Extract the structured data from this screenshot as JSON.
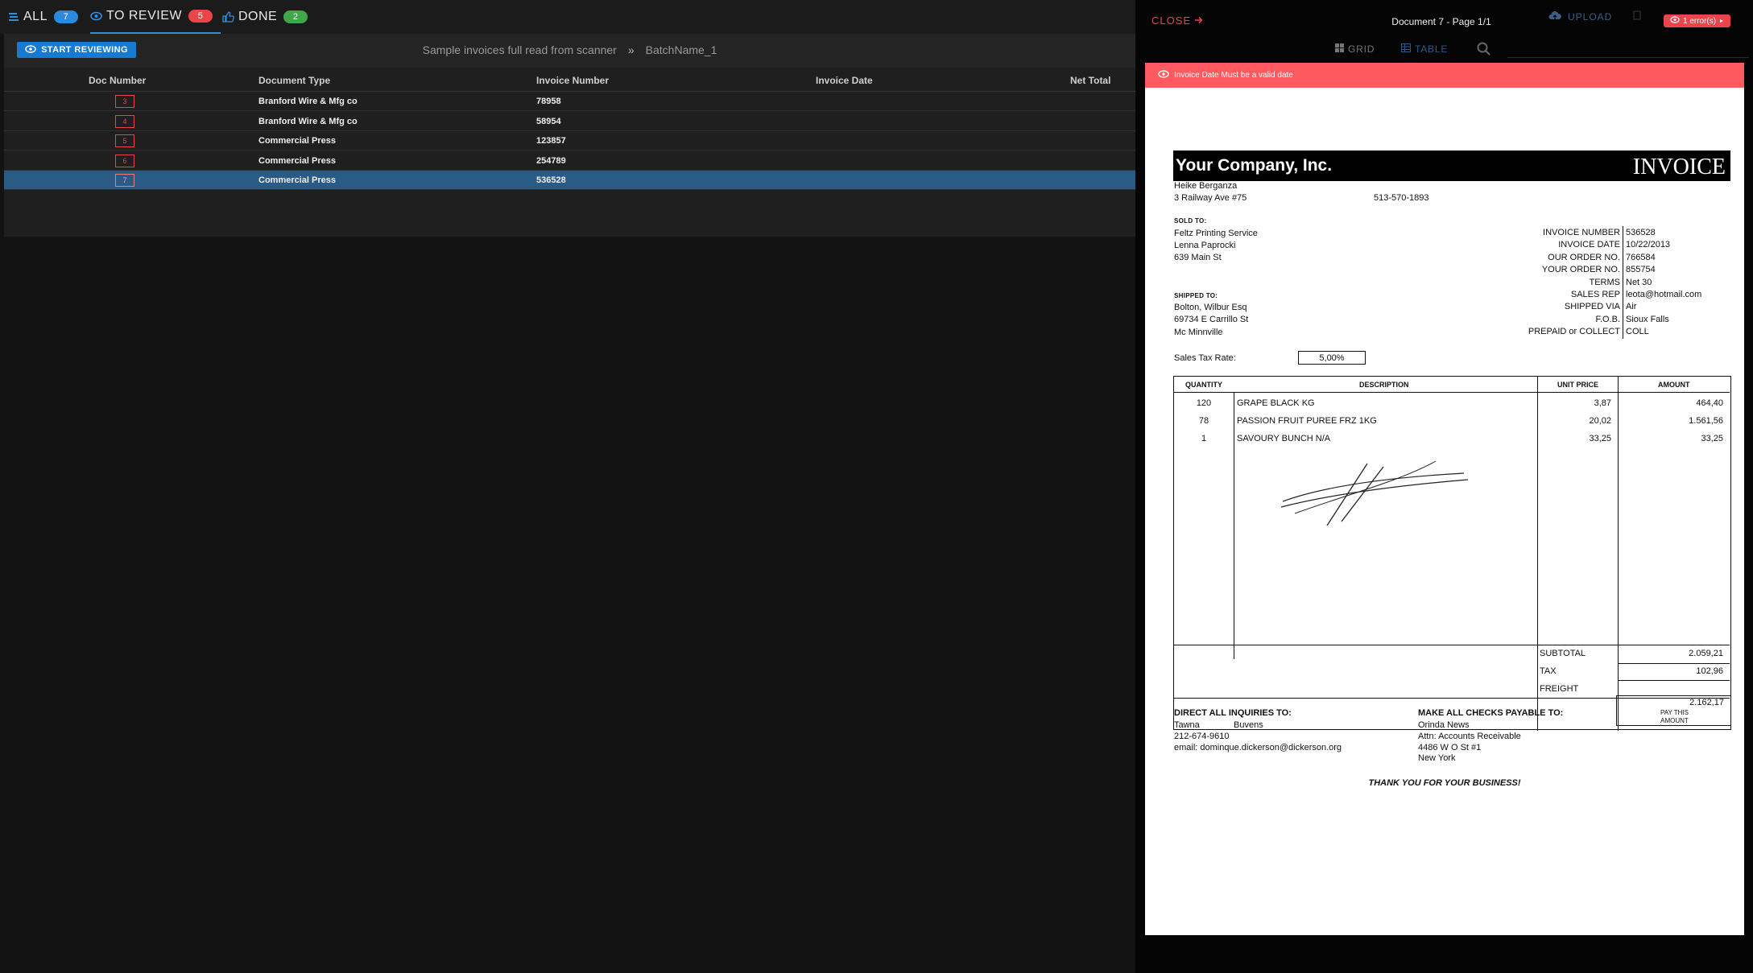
{
  "tabs": [
    {
      "label": "ALL",
      "count": "7",
      "icon": "stack-icon"
    },
    {
      "label": "TO REVIEW",
      "count": "5",
      "icon": "eye-icon"
    },
    {
      "label": "DONE",
      "count": "2",
      "icon": "thumbs-up-icon"
    }
  ],
  "toolbar": {
    "start_label": "START REVIEWING",
    "breadcrumb_batch": "Sample invoices full read from scanner",
    "breadcrumb_sep": "»",
    "breadcrumb_name": "BatchName_1"
  },
  "table": {
    "columns": [
      "Doc Number",
      "Document Type",
      "Invoice Number",
      "Invoice Date",
      "Net Total"
    ],
    "rows": [
      {
        "doc": "3",
        "type": "Branford Wire & Mfg co",
        "invoice": "78958",
        "date": "",
        "total": ""
      },
      {
        "doc": "4",
        "type": "Branford Wire & Mfg co",
        "invoice": "58954",
        "date": "",
        "total": ""
      },
      {
        "doc": "5",
        "type": "Commercial Press",
        "invoice": "123857",
        "date": "",
        "total": ""
      },
      {
        "doc": "6",
        "type": "Commercial Press",
        "invoice": "254789",
        "date": "",
        "total": ""
      },
      {
        "doc": "7",
        "type": "Commercial Press",
        "invoice": "536528",
        "date": "",
        "total": ""
      }
    ],
    "selected_index": 4
  },
  "viewer": {
    "close_label": "CLOSE",
    "title": "Document 7 - Page 1/1",
    "upload_label": "UPLOAD",
    "error_count_label": "1 error(s)",
    "grid_label": "GRID",
    "table_label": "TABLE",
    "error_message": "Invoice Date Must be a valid date"
  },
  "invoice": {
    "company": "Your Company, Inc.",
    "heading": "INVOICE",
    "contact_name": "Heike Berganza",
    "address": "3 Railway Ave #75",
    "phone": "513-570-1893",
    "sold_to_label": "SOLD TO:",
    "sold_to": [
      "Feltz Printing Service",
      "Lenna Paprocki",
      "639 Main St"
    ],
    "shipped_to_label": "SHIPPED TO:",
    "shipped_to": [
      "Bolton, Wilbur Esq",
      "69734 E Carrillo St",
      "Mc Minnville"
    ],
    "fields": [
      {
        "label": "INVOICE NUMBER",
        "value": "536528"
      },
      {
        "label": "INVOICE DATE",
        "value": "10/22/2013"
      },
      {
        "label": "OUR ORDER NO.",
        "value": "766584"
      },
      {
        "label": "YOUR ORDER NO.",
        "value": "855754"
      },
      {
        "label": "TERMS",
        "value": "Net 30"
      },
      {
        "label": "SALES REP",
        "value": "leota@hotmail.com"
      },
      {
        "label": "SHIPPED VIA",
        "value": "Air"
      },
      {
        "label": "F.O.B.",
        "value": "Sioux Falls"
      },
      {
        "label": "PREPAID or COLLECT",
        "value": "COLL"
      }
    ],
    "tax_rate_label": "Sales Tax Rate:",
    "tax_rate": "5,00%",
    "table_headers": [
      "QUANTITY",
      "DESCRIPTION",
      "UNIT PRICE",
      "AMOUNT"
    ],
    "items": [
      {
        "qty": "120",
        "desc": "GRAPE BLACK KG",
        "price": "3,87",
        "amount": "464,40"
      },
      {
        "qty": "78",
        "desc": "PASSION FRUIT PUREE FRZ 1KG",
        "price": "20,02",
        "amount": "1.561,56"
      },
      {
        "qty": "1",
        "desc": "SAVOURY BUNCH N/A",
        "price": "33,25",
        "amount": "33,25"
      }
    ],
    "subtotal_label": "SUBTOTAL",
    "subtotal": "2.059,21",
    "tax_label": "TAX",
    "tax": "102,96",
    "freight_label": "FREIGHT",
    "total": "2.162,17",
    "pay_label_1": "PAY THIS",
    "pay_label_2": "AMOUNT",
    "inquiries_label": "DIRECT ALL INQUIRIES TO:",
    "inq_first": "Tawna",
    "inq_last": "Buvens",
    "inq_phone": "212-674-9610",
    "inq_email": "email: dominque.dickerson@dickerson.org",
    "checks_label": "MAKE ALL CHECKS PAYABLE TO:",
    "checks_to": [
      "Orinda News",
      "Attn: Accounts Receivable",
      "4486 W O St #1",
      "New York"
    ],
    "thanks": "THANK YOU FOR YOUR BUSINESS!"
  }
}
